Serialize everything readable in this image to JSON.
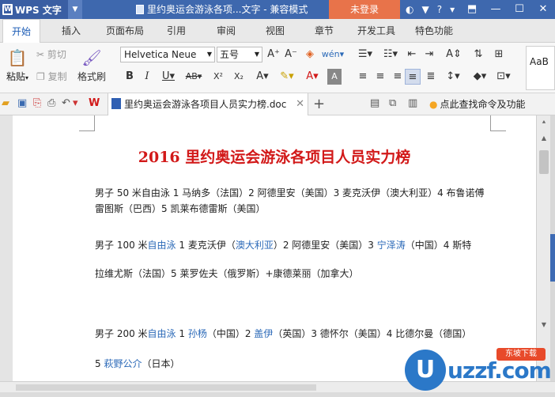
{
  "titlebar": {
    "app_name": "WPS 文字",
    "doc_title": "里约奥运会游泳各项...文字 - 兼容模式",
    "login_label": "未登录",
    "icons": [
      "skin-icon",
      "shirt-icon",
      "help-icon",
      "more-icon"
    ],
    "help_glyph": "?",
    "window_buttons": [
      "restore-icon",
      "minimize-icon",
      "maximize-icon",
      "close-icon"
    ]
  },
  "tabs": [
    "开始",
    "插入",
    "页面布局",
    "引用",
    "审阅",
    "视图",
    "章节",
    "开发工具",
    "特色功能"
  ],
  "ribbon": {
    "paste_label": "粘贴",
    "cut_label": "剪切",
    "copy_label": "复制",
    "format_painter_label": "格式刷",
    "font_name": "Helvetica Neue",
    "font_size": "五号",
    "style_preview": "AaB"
  },
  "toolbar2": {
    "doc_tab_title": "里约奥运会游泳各项目人员实力榜.doc",
    "find_command": "点此查找命令及功能"
  },
  "document": {
    "title": "2016 里约奥运会游泳各项目人员实力榜",
    "para1_line1": "男子 50 米自由泳 1 马纳多（法国）2 阿德里安（美国）3 麦克沃伊（澳大利亚）4 布鲁诺傅",
    "para1_line2": "雷图斯（巴西）5 凯莱布德雷斯（美国）",
    "para2_line1": {
      "a": "男子 100 米",
      "b": "自由泳",
      "c": " 1 麦克沃伊（",
      "d": "澳大利亚",
      "e": "）2 阿德里安（美国）3 ",
      "f": "宁泽涛",
      "g": "（中国）4 斯特"
    },
    "para2_line2": "拉维尤斯（法国）5 莱罗佐夫（俄罗斯）+康德莱丽（加拿大）",
    "para3_line1": {
      "a": "男子 200 米",
      "b": "自由泳",
      "c": " 1 ",
      "d": "孙杨",
      "e": "（中国）2 ",
      "f": "盖伊",
      "g": "（英国）3 德怀尔（美国）4 比德尔曼（德国）"
    },
    "para3_line2": {
      "a": "5 ",
      "b": "萩野公介",
      "c": "（日本）"
    }
  },
  "watermark": {
    "logo_letter": "U",
    "text": "uzzf.com",
    "badge": "东坡下载"
  },
  "colors": {
    "titlebar": "#3e68ae",
    "login": "#e8734a",
    "doc_title_red": "#d21919",
    "link_blue": "#2c6ab8",
    "active_tab_text": "#1a5bb5"
  }
}
